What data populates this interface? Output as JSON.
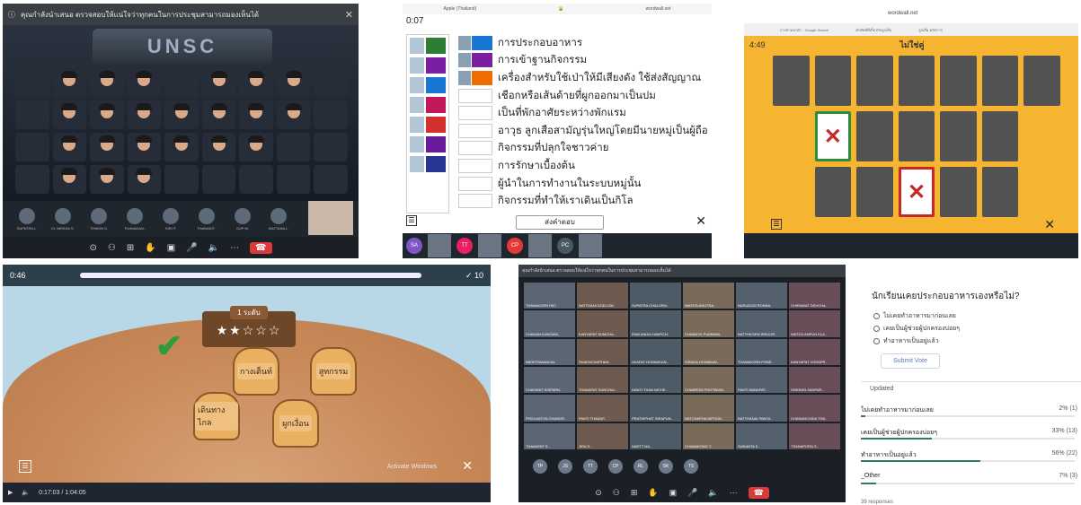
{
  "p1": {
    "topbar_text": "คุณกำลังนำเสนอ ตรวจสอบให้แน่ใจว่าทุกคนในการประชุมสามารถมองเห็นได้",
    "close": "✕",
    "banner": "UNSC",
    "thumbs": [
      "SUPATRA L.",
      "KL NIRASA S.",
      "TONKIN S.",
      "THANAKAN..",
      "SIRI P.",
      "THANAKIT..",
      "SUP W.",
      "MATTANA L."
    ],
    "controls": [
      "⊙",
      "⚇",
      "⊞",
      "✋",
      "▣",
      "🎤",
      "🔈",
      "⋯"
    ],
    "end_call": "☎"
  },
  "p2": {
    "hdr_left": "Apple (Thailand)",
    "hdr_right": "wordwall.net",
    "timer": "0:07",
    "tile_colors": [
      "#2e7d32",
      "#7b1fa2",
      "#1976d2",
      "#c2185b",
      "#d32f2f",
      "#6a1b9a",
      "#283593"
    ],
    "rows": [
      {
        "text": "การประกอบอาหาร",
        "filled": true,
        "color": "#1976d2"
      },
      {
        "text": "การเข้าฐานกิจกรรม",
        "filled": true,
        "color": "#7b1fa2"
      },
      {
        "text": "เครื่องสำหรับใช้เป่าให้มีเสียงดัง ใช้ส่งสัญญาณ",
        "filled": true,
        "color": "#ef6c00"
      },
      {
        "text": "เชือกหรือเส้นด้ายที่ผูกออกมาเป็นปม",
        "filled": false
      },
      {
        "text": "เป็นที่พักอาศัยระหว่างพักแรม",
        "filled": false
      },
      {
        "text": "อาวุธ ลูกเสือสามัญรุ่นใหญ่โดยมีนายหมู่เป็นผู้ถือ",
        "filled": false
      },
      {
        "text": "กิจกรรมที่ปลุกใจชาวค่าย",
        "filled": false
      },
      {
        "text": "การรักษาเบื้องต้น",
        "filled": false
      },
      {
        "text": "ผู้นำในการทำงานในระบบหมู่นั้น",
        "filled": false
      },
      {
        "text": "กิจกรรมที่ทำให้เราเดินเป็นกิโล",
        "filled": false
      }
    ],
    "submit": "ส่งคำตอบ",
    "menu": "☰",
    "close": "✕",
    "chips": [
      {
        "label": "SA",
        "color": "#7e57c2"
      },
      {
        "label": "TT",
        "color": "#e91e63"
      },
      {
        "label": "CP",
        "color": "#e53935"
      },
      {
        "label": "PC",
        "color": "#455a64"
      }
    ]
  },
  "p3": {
    "url": "wordwall.net",
    "tabs": [
      "การตามหาคำ - Google Search",
      "คำศัพท์ที่เกี่ยวกับลูกเสือ",
      "ลูกเสือ-หลักการ"
    ],
    "timer": "4:49",
    "title": "ไม่ใช่คู่",
    "menu": "☰",
    "close": "✕"
  },
  "p4": {
    "timer": "0:46",
    "count": "✓ 10",
    "level": "1 ระดับ",
    "stars": "★★☆☆☆",
    "moles": [
      {
        "label": "กางเต็นท์"
      },
      {
        "label": "สูทกรรม"
      },
      {
        "label": "เดินทางไกล"
      },
      {
        "label": "ผูกเงื่อน"
      }
    ],
    "time": "0:17:03 / 1:04:05",
    "activate": "Activate Windows",
    "menu": "☰",
    "close": "✕"
  },
  "p5": {
    "topbar_text": "คุณกำลังนำเสนอ ตรวจสอบให้แน่ใจว่าทุกคนในการประชุมสามารถมองเห็นได้",
    "names": [
      "THANAKORN PAT..",
      "NATTHANI DOELOW..",
      "SUPATRA CHALORN..",
      "WASITA ANUTRA..",
      "NARUDOM RONNA..",
      "CHIRAWAT DEHCHA..",
      "CHANAN KUNGWA..",
      "KANYAPAT SUMCHA..",
      "RAM ANUN KANPICH..",
      "CHANNYK PUMMWA..",
      "NATTHKORN SRIUOR..",
      "WATCH ANPUN KLA..",
      "NIENTRAMAKUN..",
      "SHAKNCHAPHAN..",
      "AKADIS HONNAKAN..",
      "SIRADA HONNKAN..",
      "THANAKORN PONE..",
      "KANYAPAT VORAPR..",
      "CHAYANIT SISPARN..",
      "THANAPAT SUNCHAI..",
      "DANTI THAN NICHE..",
      "CHANRON PHOTINUM..",
      "PANTI NANAPAT..",
      "ONKRAN SANPAR..",
      "PHOLNATON CHANGR..",
      "PANTI THANAP..",
      "PRATHIPHAT SIRAPUN..",
      "NATCHAPHA NIPHON..",
      "NATTHANAI PANYA..",
      "CHANANCHIDA THA..",
      "THANAPAT S..",
      "JIRA S..",
      "NARTT NA..",
      "CHANAKONG T..",
      "SUNANTA K..",
      "TSANAPORN S.."
    ],
    "strip": [
      "TP",
      "JS",
      "TT",
      "CP",
      "RL",
      "SK",
      "TS"
    ],
    "controls": [
      "⊙",
      "⚇",
      "⊞",
      "✋",
      "▣",
      "🎤",
      "🔈",
      "⋯"
    ],
    "end_call": "☎"
  },
  "p6": {
    "question": "นักเรียนเคยประกอบอาหารเองหรือไม่?",
    "options": [
      "ไม่เคยทำอาหารมาก่อนเลย",
      "เคยเป็นผู้ช่วยผู้ปกครองบ่อยๆ",
      "ทำอาหารเป็นอยู่แล้ว"
    ],
    "vote": "Submit Vote",
    "updated": "Updated",
    "results": [
      {
        "label": "ไม่เคยทำอาหารมาก่อนเลย",
        "pct": "2% (1)",
        "value": 2
      },
      {
        "label": "เคยเป็นผู้ช่วยผู้ปกครองบ่อยๆ",
        "pct": "33% (13)",
        "value": 33
      },
      {
        "label": "ทำอาหารเป็นอยู่แล้ว",
        "pct": "56% (22)",
        "value": 56
      },
      {
        "label": "_Other",
        "pct": "7% (3)",
        "value": 7
      }
    ],
    "responses": "39 responses"
  }
}
